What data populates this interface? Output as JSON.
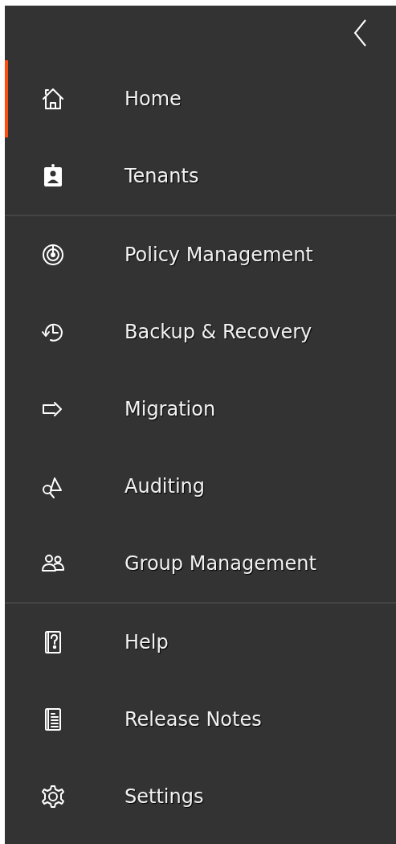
{
  "sidebar": {
    "collapse_button": {
      "kind": "chevron-left"
    },
    "sections": [
      {
        "items": [
          {
            "label": "Home",
            "selected": true
          },
          {
            "label": "Tenants",
            "selected": false
          }
        ]
      },
      {
        "items": [
          {
            "label": "Policy Management",
            "selected": false
          },
          {
            "label": "Backup & Recovery",
            "selected": false
          },
          {
            "label": "Migration",
            "selected": false
          },
          {
            "label": "Auditing",
            "selected": false
          },
          {
            "label": "Group Management",
            "selected": false
          }
        ]
      },
      {
        "items": [
          {
            "label": "Help",
            "selected": false
          },
          {
            "label": "Release Notes",
            "selected": false
          },
          {
            "label": "Settings",
            "selected": false
          }
        ]
      }
    ]
  }
}
